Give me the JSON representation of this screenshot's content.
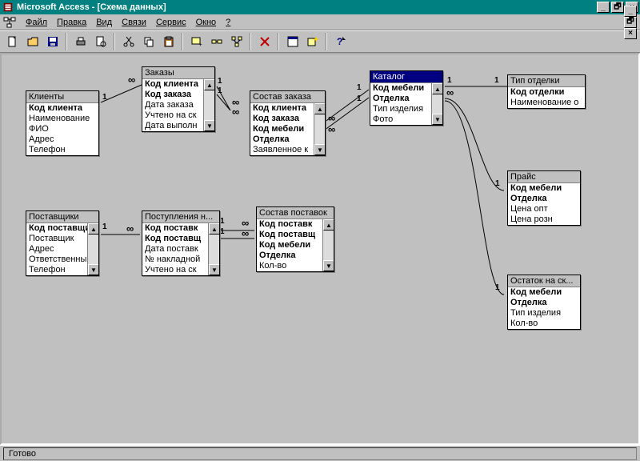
{
  "app": {
    "title": "Microsoft Access - [Схема данных]",
    "min": "_",
    "max": "🗗",
    "close": "×"
  },
  "menu": {
    "items": [
      "Файл",
      "Правка",
      "Вид",
      "Связи",
      "Сервис",
      "Окно",
      "?"
    ]
  },
  "status": {
    "text": "Готово"
  },
  "rel_labels": {
    "one": "1",
    "many": "∞"
  },
  "tables": {
    "clients": {
      "title": "Клиенты",
      "fields": [
        {
          "t": "Код клиента",
          "b": true
        },
        {
          "t": "Наименование"
        },
        {
          "t": "ФИО"
        },
        {
          "t": "Адрес"
        },
        {
          "t": "Телефон"
        }
      ]
    },
    "orders": {
      "title": "Заказы",
      "fields": [
        {
          "t": "Код клиента",
          "b": true
        },
        {
          "t": "Код заказа",
          "b": true
        },
        {
          "t": "Дата заказа"
        },
        {
          "t": "Учтено на ск"
        },
        {
          "t": "Дата выполн"
        }
      ]
    },
    "order_items": {
      "title": "Состав заказа",
      "fields": [
        {
          "t": "Код клиента",
          "b": true
        },
        {
          "t": "Код заказа",
          "b": true
        },
        {
          "t": "Код мебели",
          "b": true
        },
        {
          "t": "Отделка",
          "b": true
        },
        {
          "t": "Заявленное к"
        }
      ]
    },
    "catalog": {
      "title": "Каталог",
      "fields": [
        {
          "t": "Код мебели",
          "b": true
        },
        {
          "t": "Отделка",
          "b": true
        },
        {
          "t": "Тип изделия"
        },
        {
          "t": "Фото"
        }
      ]
    },
    "finish_type": {
      "title": "Тип отделки",
      "fields": [
        {
          "t": "Код отделки",
          "b": true
        },
        {
          "t": "Наименование о"
        }
      ]
    },
    "price": {
      "title": "Прайс",
      "fields": [
        {
          "t": "Код мебели",
          "b": true
        },
        {
          "t": "Отделка",
          "b": true
        },
        {
          "t": "Цена опт"
        },
        {
          "t": "Цена розн"
        }
      ]
    },
    "suppliers": {
      "title": "Поставщики",
      "fields": [
        {
          "t": "Код поставщика",
          "b": true
        },
        {
          "t": "Поставщик"
        },
        {
          "t": "Адрес"
        },
        {
          "t": "Ответственный"
        },
        {
          "t": "Телефон"
        }
      ]
    },
    "deliveries": {
      "title": "Поступления н...",
      "fields": [
        {
          "t": "Код поставк",
          "b": true
        },
        {
          "t": "Код поставщ",
          "b": true
        },
        {
          "t": "Дата поставк"
        },
        {
          "t": "№ накладной"
        },
        {
          "t": "Учтено на ск"
        }
      ]
    },
    "delivery_items": {
      "title": "Состав поставок",
      "fields": [
        {
          "t": "Код поставк",
          "b": true
        },
        {
          "t": "Код поставщ",
          "b": true
        },
        {
          "t": "Код мебели",
          "b": true
        },
        {
          "t": "Отделка",
          "b": true
        },
        {
          "t": "Кол-во"
        }
      ]
    },
    "stock": {
      "title": "Остаток на ск...",
      "fields": [
        {
          "t": "Код мебели",
          "b": true
        },
        {
          "t": "Отделка",
          "b": true
        },
        {
          "t": "Тип изделия"
        },
        {
          "t": "Кол-во"
        }
      ]
    }
  }
}
